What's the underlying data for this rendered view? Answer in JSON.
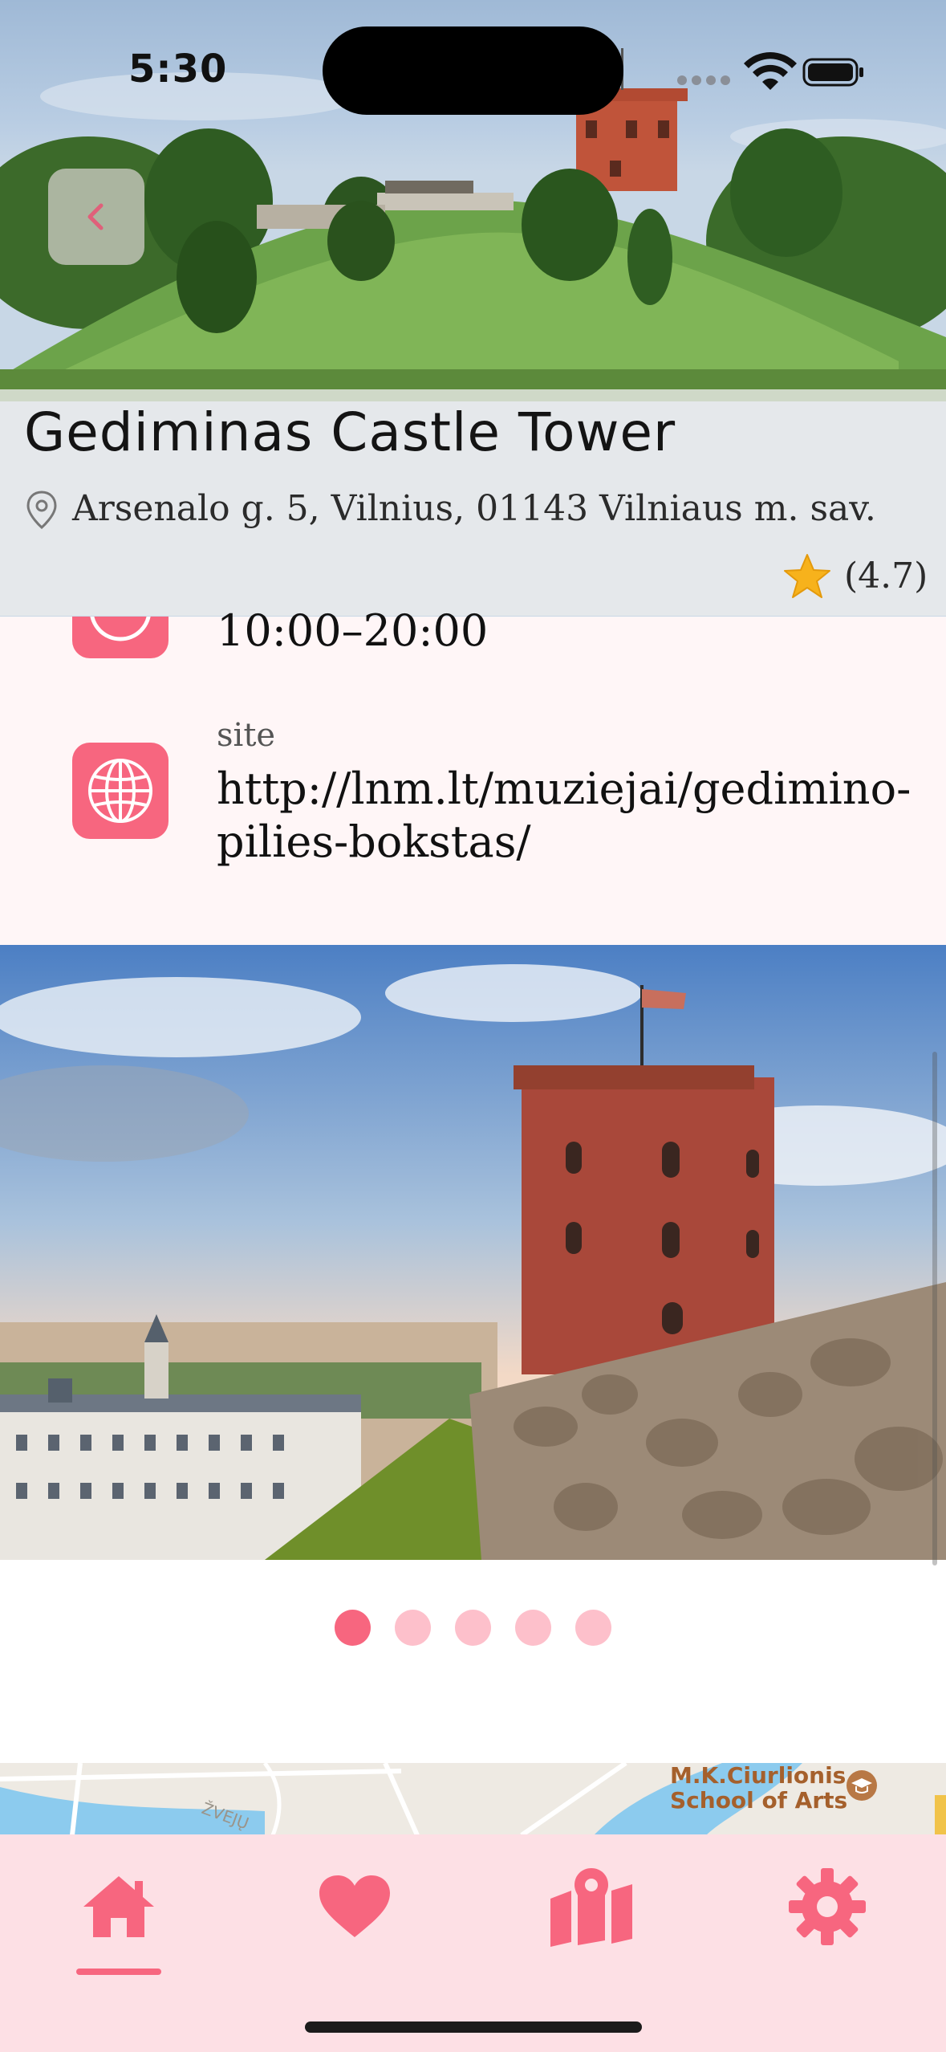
{
  "status_bar": {
    "time": "5:30"
  },
  "header": {
    "back_icon": "chevron-left-icon",
    "title": "Gediminas Castle Tower",
    "address": "Arsenalo g. 5, Vilnius, 01143 Vilniaus m. sav.",
    "rating": "(4.7)"
  },
  "info": {
    "hours": "10:00–20:00",
    "site_label": "site",
    "site_url": "http://lnm.lt/muziejai/gedimino-pilies-bokstas/"
  },
  "gallery": {
    "count": 5,
    "active_index": 0
  },
  "map": {
    "poi_label_line1": "M.K.Ciurlionis",
    "poi_label_line2": "School of Arts",
    "street": "ŽVEJŲ"
  },
  "tabs": [
    {
      "icon": "home-icon",
      "selected": true
    },
    {
      "icon": "heart-icon",
      "selected": false
    },
    {
      "icon": "map-icon",
      "selected": false
    },
    {
      "icon": "gear-icon",
      "selected": false
    }
  ],
  "colors": {
    "accent": "#f7667f",
    "accent_light": "#fdc0cb",
    "tabbar_bg": "#fde0e5",
    "info_bg": "#fff6f7"
  }
}
